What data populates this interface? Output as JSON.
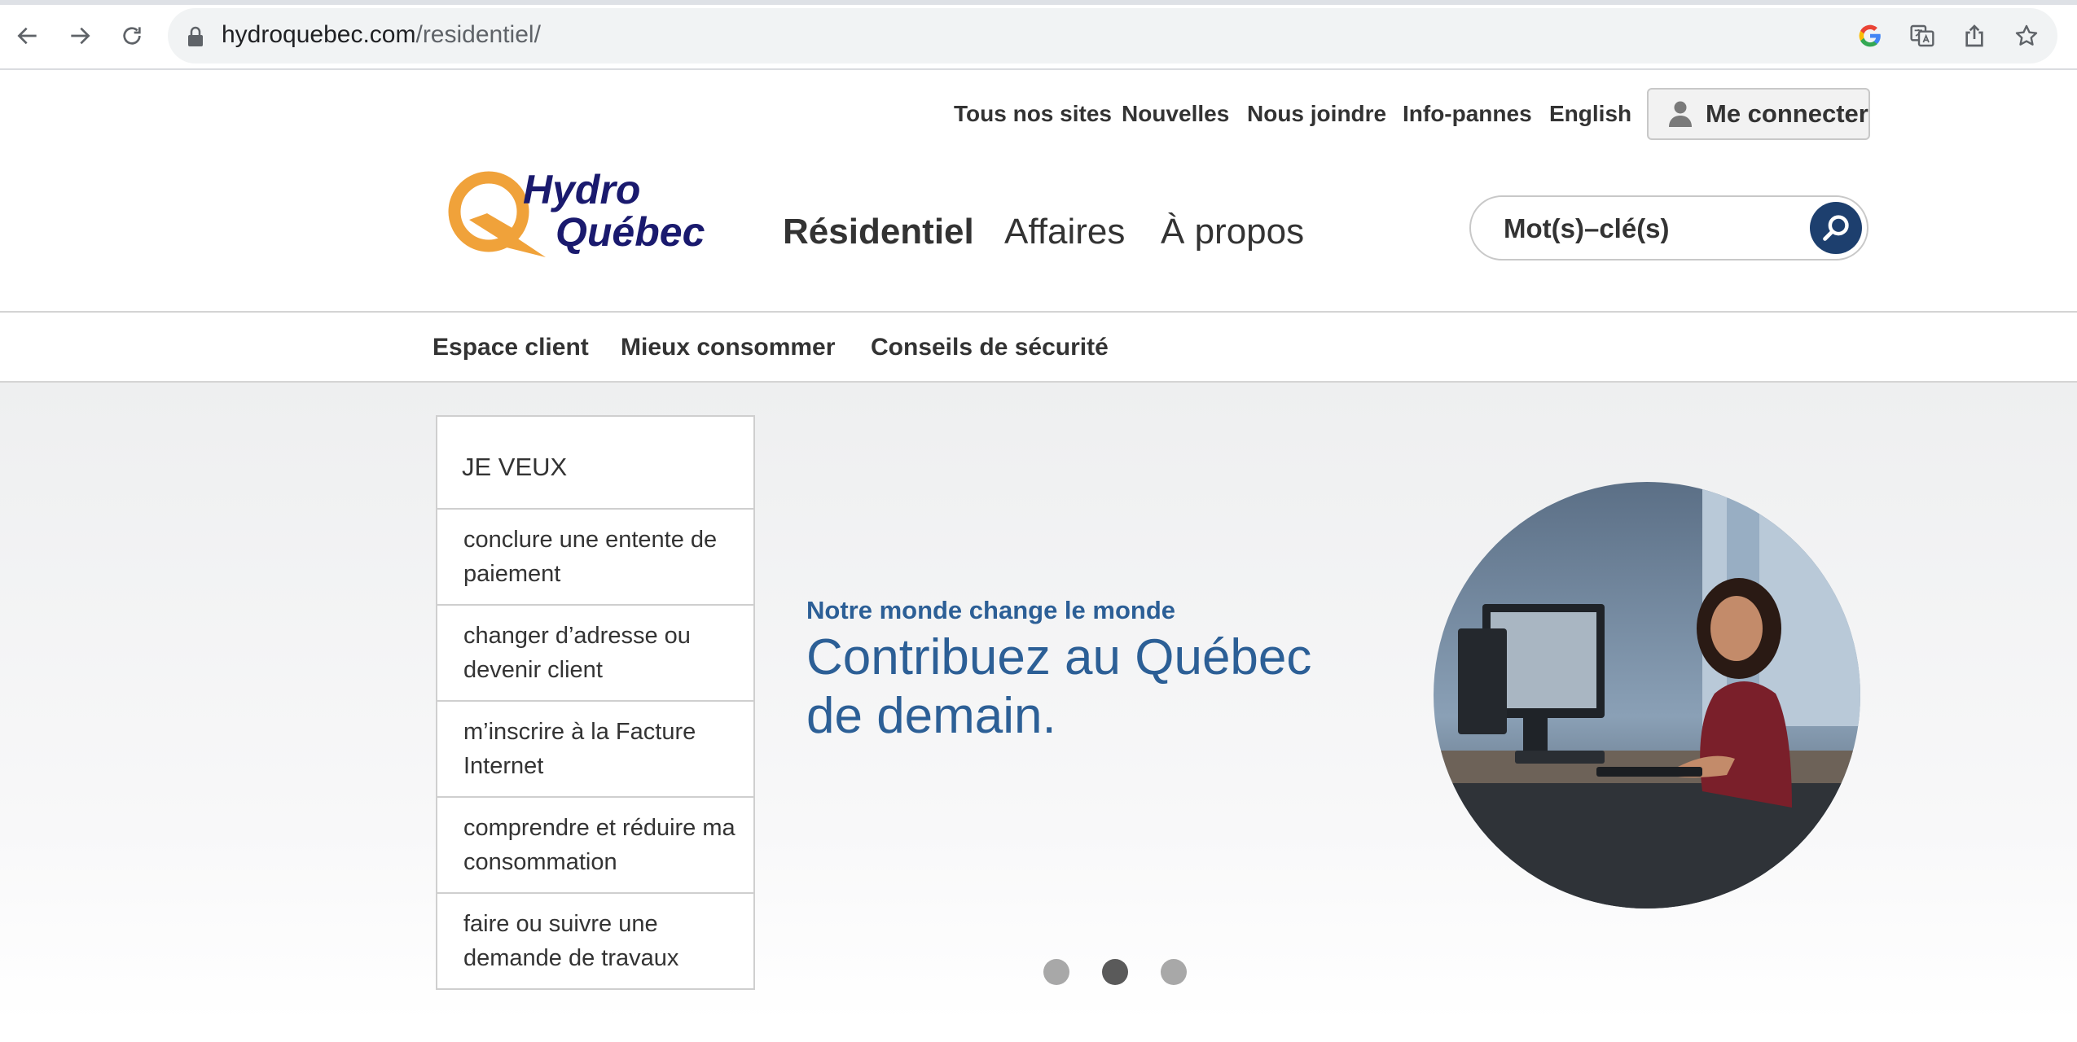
{
  "browser": {
    "url_domain": "hydroquebec.com",
    "url_path": "/residentiel/"
  },
  "utility_nav": {
    "items": [
      "Tous nos sites",
      "Nouvelles",
      "Nous joindre",
      "Info-pannes",
      "English"
    ],
    "login_label": "Me connecter"
  },
  "logo": {
    "line1": "Hydro",
    "line2": "Québec"
  },
  "main_nav": {
    "items": [
      "Résidentiel",
      "Affaires",
      "À propos"
    ],
    "active": "Résidentiel"
  },
  "search": {
    "placeholder": "Mot(s)–clé(s)"
  },
  "sub_nav": {
    "items": [
      "Espace client",
      "Mieux consommer",
      "Conseils de sécurité"
    ]
  },
  "je_veux": {
    "title": "JE VEUX",
    "items": [
      "conclure une entente de paiement",
      "changer d’adresse ou devenir client",
      "m’inscrire à la Facture Internet",
      "comprendre et réduire ma consommation",
      "faire ou suivre une demande de travaux"
    ]
  },
  "hero": {
    "tagline": "Notre monde change le monde",
    "headline": "Contribuez au Québec de demain.",
    "active_slide": 2,
    "slide_count": 3
  },
  "colors": {
    "brand_orange": "#f0a23a",
    "brand_navy": "#1a1a6e",
    "headline_blue": "#2c5f96",
    "search_button": "#1d3f6e"
  }
}
